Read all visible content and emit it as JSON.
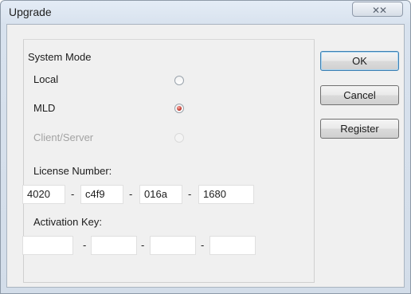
{
  "window": {
    "title": "Upgrade",
    "close_icon": "close-icon"
  },
  "system_mode": {
    "label": "System Mode",
    "options": [
      {
        "label": "Local",
        "selected": false,
        "enabled": true
      },
      {
        "label": "MLD",
        "selected": true,
        "enabled": true
      },
      {
        "label": "Client/Server",
        "selected": false,
        "enabled": false
      }
    ]
  },
  "license": {
    "label": "License Number:",
    "parts": [
      "4020",
      "c4f9",
      "016a",
      "1680"
    ],
    "separator": "-"
  },
  "activation": {
    "label": "Activation Key:",
    "parts": [
      "",
      "",
      "",
      ""
    ],
    "separator": "-"
  },
  "buttons": {
    "ok": "OK",
    "cancel": "Cancel",
    "register": "Register"
  },
  "colors": {
    "radio_selected": "#b1261b",
    "default_button_border": "#3c7fb1"
  }
}
